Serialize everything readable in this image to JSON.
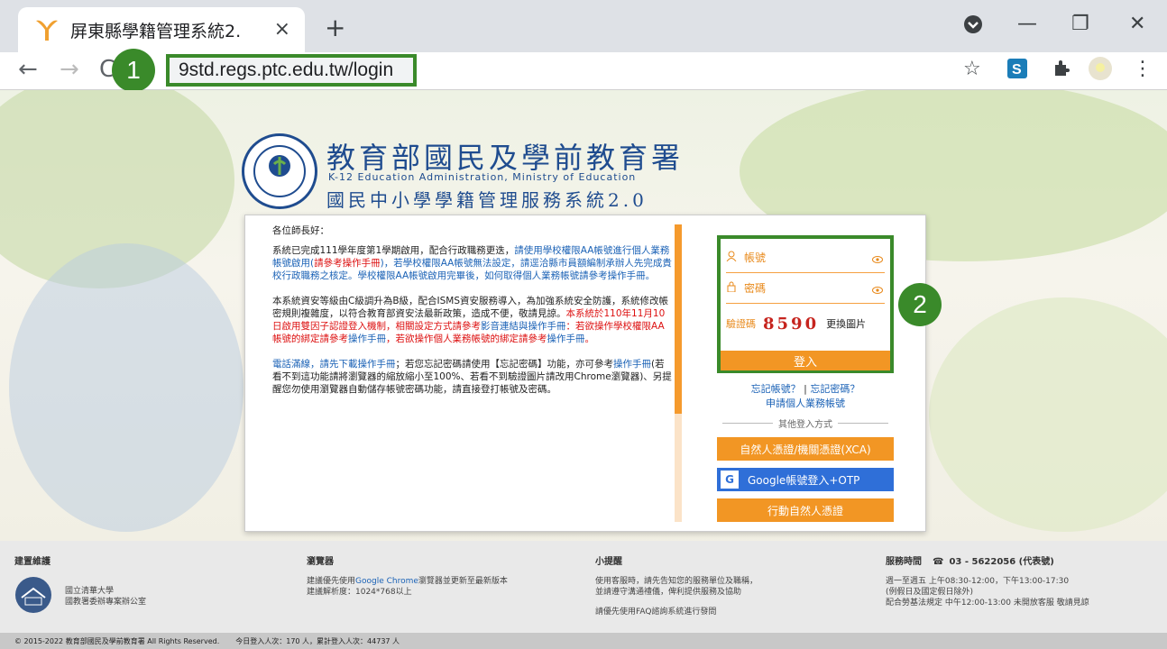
{
  "browser": {
    "tab_title": "屏東縣學籍管理系統2.",
    "url": "9std.regs.ptc.edu.tw/login",
    "marker1": "1",
    "marker2": "2",
    "icons": {
      "back": "←",
      "forward": "→",
      "reload": "C",
      "star": "☆",
      "extensions": "puzzle-icon",
      "menu": "⋮",
      "new_tab": "+",
      "close": "×",
      "minimize": "—",
      "restore": "❐",
      "window_close": "✕"
    }
  },
  "header": {
    "agency": "教育部國民及學前教育署",
    "english": "K-12 Education Administration, Ministry of Education",
    "system": "國民中小學學籍管理服務系統2.0"
  },
  "notice": {
    "greeting": "各位師長好：",
    "p1a": "系統已完成111學年度第1學期啟用，配合行政職務更迭，",
    "p1b": "請使用學校權限AA帳號進行個人業務帳號啟用(",
    "p1c": "請參考操作手冊",
    "p1d": ")，若學校權限AA帳號無法設定，請逕洽縣市員額編制承辦人先完成貴校行政職務之核定。學校權限AA帳號啟用完畢後，如何取得個人業務帳號請參考操作手冊。",
    "p2a": "本系統資安等級由C級調升為B級，配合ISMS資安服務導入，為加強系統安全防護，系統修改帳密規則複雜度，以符合教育部資安法最新政策，造成不便，敬請見諒。",
    "p2b": "本系統於110年11月10日啟用雙因子認證登入機制，相關設定方式請參考",
    "p2c": "影音連結與操作手冊",
    "p2d": "：若欲操作學校權限AA帳號的綁定請參考",
    "p2e": "操作手冊",
    "p2f": "，若欲操作個人業務帳號的綁定請參考",
    "p2g": "操作手冊",
    "p2h": "。",
    "p3a": "電話滿線，請先下載操作手冊",
    "p3b": "；若您忘記密碼請使用【忘記密碼】功能，亦可參考",
    "p3c": "操作手冊",
    "p3d": "(若看不到這功能請將瀏覽器的縮放縮小至100%、若看不到驗證圖片請改用Chrome瀏覽器)、另提醒您勿使用瀏覽器自動儲存帳號密碼功能，請直接登打帳號及密碼。"
  },
  "login": {
    "account_label": "帳號",
    "password_label": "密碼",
    "captcha_label": "驗證碼",
    "captcha_value": "8590",
    "refresh_label": "更換圖片",
    "login_button": "登入",
    "forgot_account": "忘記帳號？",
    "separator": "|",
    "forgot_password": "忘記密碼？",
    "apply": "申請個人業務帳號",
    "other_methods": "其他登入方式",
    "xca_button": "自然人憑證/機關憑證(XCA)",
    "google_button": "Google帳號登入+OTP",
    "mobile_button": "行動自然人憑證"
  },
  "footer": {
    "col1_title": "建置維護",
    "col1_line1": "國立清華大學",
    "col1_line2": "國教署委辦專案辦公室",
    "col2_title": "瀏覽器",
    "col2_line1a": "建議優先使用",
    "col2_line1b": "Google Chrome",
    "col2_line1c": "瀏覽器並更新至最新版本",
    "col2_line2": "建議解析度：1024*768以上",
    "col3_title": "小提醒",
    "col3_line1": "使用客服時，請先告知您的服務單位及職稱，",
    "col3_line2": "並請遵守溝通禮儀，俾利提供服務及協助",
    "col3_line3": "請優先使用FAQ諮詢系統進行發問",
    "col4_title": "服務時間",
    "col4_phone": "03 - 5622056 (代表號)",
    "col4_line1": "週一至週五 上午08:30-12:00，下午13:00-17:30",
    "col4_line2": "(例假日及國定假日除外)",
    "col4_line3": "配合勞基法規定 中午12:00-13:00 未開放客服 敬請見諒",
    "copyright": "© 2015-2022 教育部國民及學前教育署 All Rights Reserved.",
    "stats": "今日登入人次：170 人，累計登入人次：44737 人"
  },
  "colors": {
    "accent_green": "#3a8a2a",
    "orange": "#f29624",
    "blue": "#1f4c8f",
    "link": "#1b62b6",
    "red": "#d11111"
  }
}
